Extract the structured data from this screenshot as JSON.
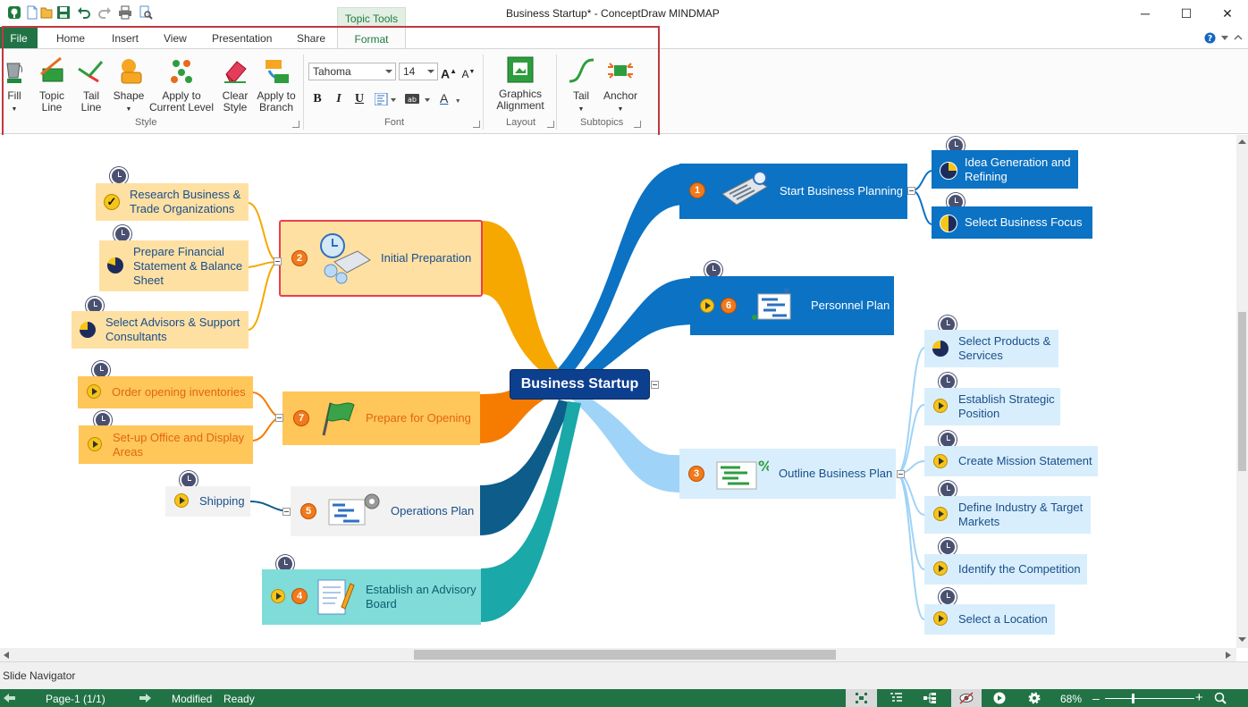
{
  "window": {
    "title": "Business Startup* - ConceptDraw MINDMAP",
    "context_tab": "Topic Tools",
    "minimize": "─",
    "maximize": "☐",
    "close": "✕"
  },
  "tabs": [
    "File",
    "Home",
    "Insert",
    "View",
    "Presentation",
    "Share",
    "Format"
  ],
  "ribbon": {
    "style": {
      "label": "Style",
      "fill": "Fill",
      "topic_line": "Topic Line",
      "tail_line": "Tail Line",
      "shape": "Shape",
      "apply_current_level": "Apply to Current Level",
      "clear_style": "Clear Style",
      "apply_branch": "Apply to Branch"
    },
    "font": {
      "label": "Font",
      "family": "Tahoma",
      "size": "14",
      "bold": "B",
      "italic": "I",
      "underline": "U",
      "color": "A"
    },
    "layout": {
      "label": "Layout",
      "graphics_alignment": "Graphics Alignment"
    },
    "subtopics": {
      "label": "Subtopics",
      "tail": "Tail",
      "anchor": "Anchor"
    }
  },
  "map": {
    "central": "Business Startup",
    "topics": {
      "t1": "Start Business Planning",
      "t1a": "Idea Generation and Refining",
      "t1b": "Select Business Focus",
      "t6": "Personnel Plan",
      "t3": "Outline Business Plan",
      "t3a": "Select Products & Services",
      "t3b": "Establish Strategic Position",
      "t3c": "Create Mission Statement",
      "t3d": "Define Industry & Target Markets",
      "t3e": "Identify the Competition",
      "t3f": "Select a Location",
      "t2": "Initial Preparation",
      "t2a": "Research Business & Trade Organizations",
      "t2b": "Prepare Financial Statement & Balance Sheet",
      "t2c": "Select Advisors & Support Consultants",
      "t7": "Prepare for Opening",
      "t7a": "Order opening inventories",
      "t7b": "Set-up Office and Display Areas",
      "t5": "Operations Plan",
      "t5a": "Shipping",
      "t4": "Establish an Advisory Board"
    },
    "numbers": {
      "n1": "1",
      "n2": "2",
      "n3": "3",
      "n4": "4",
      "n5": "5",
      "n6": "6",
      "n7": "7"
    }
  },
  "slide_navigator": "Slide Navigator",
  "status": {
    "page": "Page-1 (1/1)",
    "modified": "Modified",
    "ready": "Ready",
    "zoom": "68%",
    "minus": "–",
    "plus": "+"
  },
  "colors": {
    "accent": "#217346",
    "central": "#0d3f8f",
    "orange_branch": "#f6a800",
    "blue_branch": "#0b72c4",
    "light_blue_branch": "#9fd3f7",
    "teal_branch": "#1aa8a8"
  }
}
